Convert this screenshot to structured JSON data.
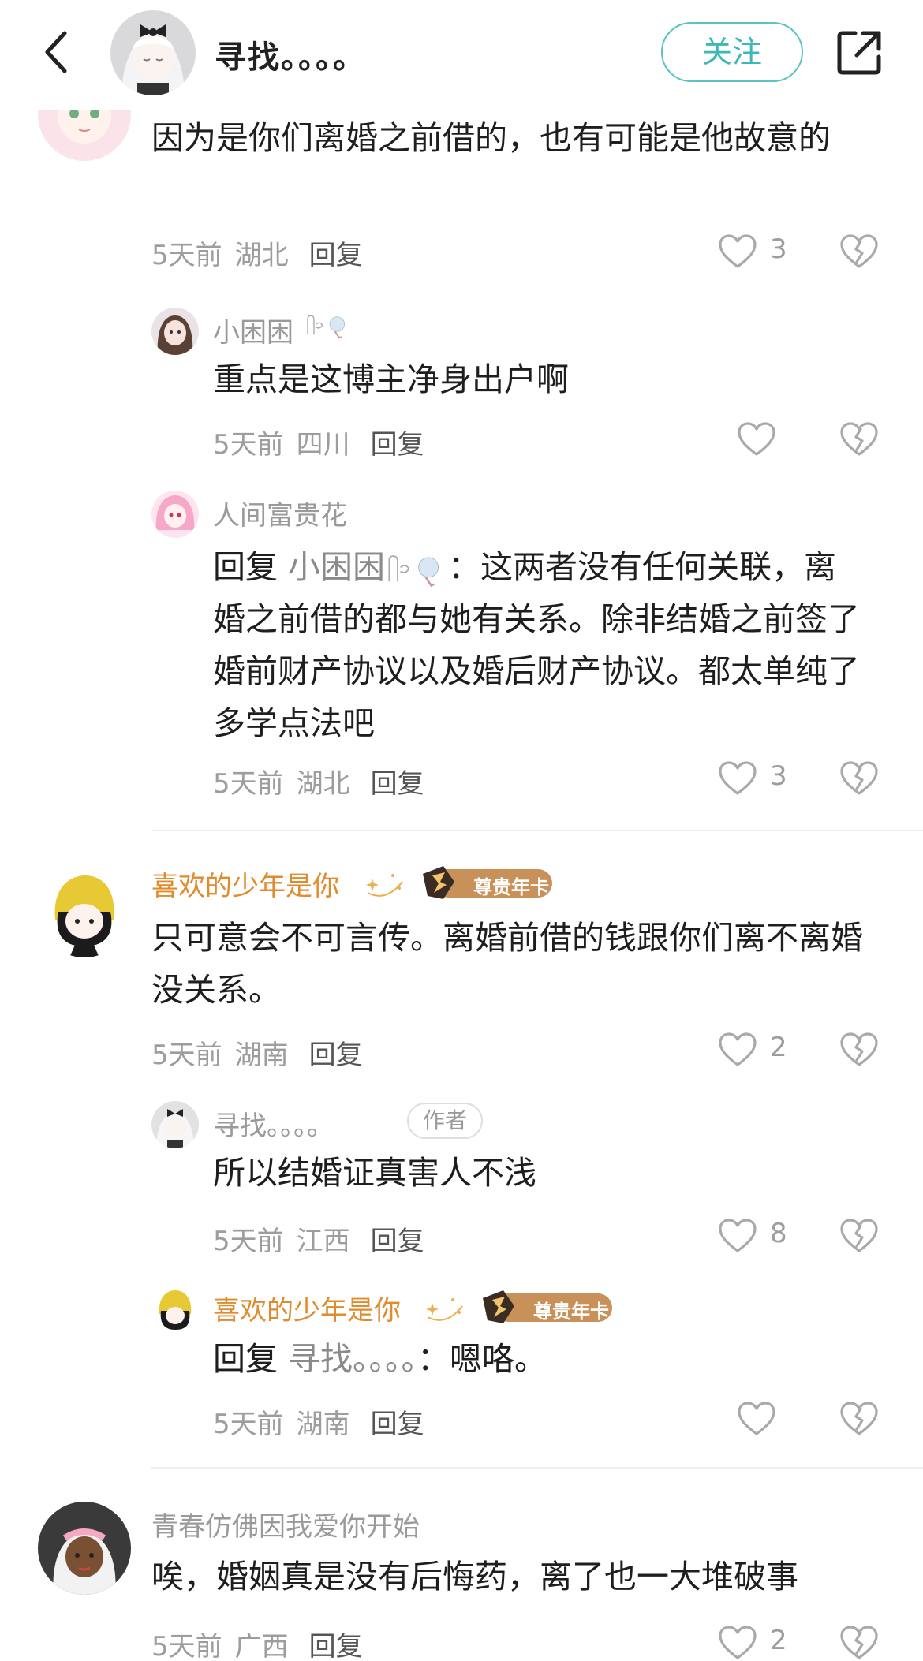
{
  "header": {
    "title": "寻找。。。。",
    "follow_label": "关注"
  },
  "comments": [
    {
      "text": "因为是你们离婚之前借的，也有可能是他故意的",
      "time": "5天前",
      "location": "湖北",
      "reply_label": "回复",
      "likes": "3"
    },
    {
      "name": "小困困",
      "text": "重点是这博主净身出户啊",
      "time": "5天前",
      "location": "四川",
      "reply_label": "回复",
      "likes": ""
    },
    {
      "name": "人间富贵花",
      "reply_prefix": "回复",
      "reply_to": "小困困",
      "text": "：这两者没有任何关联，离婚之前借的都与她有关系。除非结婚之前签了婚前财产协议以及婚后财产协议。都太单纯了 多学点法吧",
      "time": "5天前",
      "location": "湖北",
      "reply_label": "回复",
      "likes": "3"
    },
    {
      "name": "喜欢的少年是你",
      "vip_badge": "尊贵年卡",
      "text": "只可意会不可言传。离婚前借的钱跟你们离不离婚没关系。",
      "time": "5天前",
      "location": "湖南",
      "reply_label": "回复",
      "likes": "2"
    },
    {
      "name": "寻找。。。。",
      "author_badge": "作者",
      "text": "所以结婚证真害人不浅",
      "time": "5天前",
      "location": "江西",
      "reply_label": "回复",
      "likes": "8"
    },
    {
      "name": "喜欢的少年是你",
      "vip_badge": "尊贵年卡",
      "reply_prefix": "回复",
      "reply_to": "寻找。。。。",
      "text": "：嗯咯。",
      "time": "5天前",
      "location": "湖南",
      "reply_label": "回复",
      "likes": ""
    },
    {
      "name": "青春仿佛因我爱你开始",
      "text": "唉，婚姻真是没有后悔药，离了也一大堆破事",
      "time": "5天前",
      "location": "广西",
      "reply_label": "回复",
      "likes": "2"
    }
  ],
  "colors": {
    "accent": "#3fb7b7",
    "vip_name": "#e08b2e",
    "meta": "#9d9d9d"
  },
  "icons": [
    "back-arrow-icon",
    "share-icon",
    "heart-icon",
    "broken-heart-icon"
  ]
}
